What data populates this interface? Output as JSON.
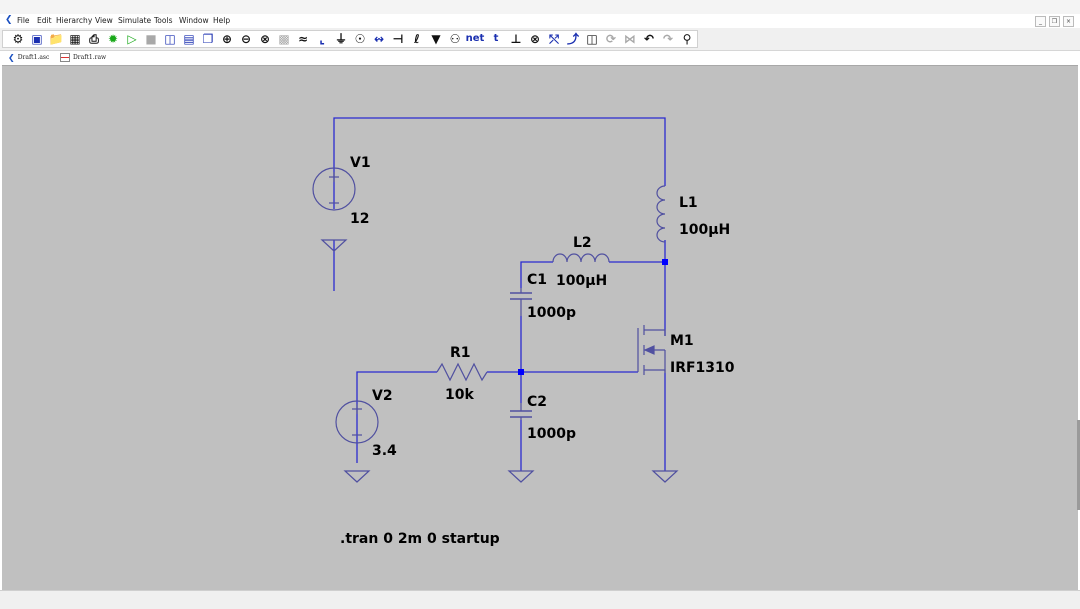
{
  "window": {
    "title": ""
  },
  "menu": {
    "file": "File",
    "edit": "Edit",
    "hierarchy": "Hierarchy",
    "view": "View",
    "simulate": "Simulate",
    "tools": "Tools",
    "window": "Window",
    "help": "Help"
  },
  "toolbar": {
    "net_label": "net",
    "t_label": "t"
  },
  "tabs": {
    "schematic": "Draft1.asc",
    "raw": "Draft1.raw"
  },
  "schematic": {
    "v1": {
      "name": "V1",
      "value": "12"
    },
    "v2": {
      "name": "V2",
      "value": "3.4"
    },
    "l1": {
      "name": "L1",
      "value": "100µH"
    },
    "l2": {
      "name": "L2",
      "value": "100µH"
    },
    "c1": {
      "name": "C1",
      "value": "1000p"
    },
    "c2": {
      "name": "C2",
      "value": "1000p"
    },
    "r1": {
      "name": "R1",
      "value": "10k"
    },
    "m1": {
      "name": "M1",
      "value": "IRF1310"
    },
    "directive": ".tran 0 2m 0 startup"
  },
  "colors": {
    "wire": "#2b2bd0",
    "component": "#5050a0",
    "junction": "#0000ff",
    "canvas": "#c0c0c0"
  }
}
